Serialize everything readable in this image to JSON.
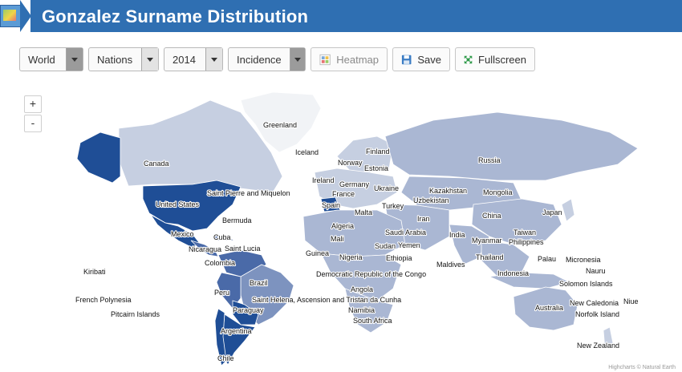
{
  "header": {
    "title": "Gonzalez Surname Distribution",
    "logo_icon": "map-logo-icon"
  },
  "toolbar": {
    "region": "World",
    "level": "Nations",
    "year": "2014",
    "measure": "Incidence",
    "heatmap_label": "Heatmap",
    "save_label": "Save",
    "fullscreen_label": "Fullscreen"
  },
  "zoom": {
    "in_label": "+",
    "out_label": "-"
  },
  "map": {
    "colors": {
      "highest": "#1f4e96",
      "high": "#4a6aa8",
      "medium": "#7d93bf",
      "low": "#aab7d3",
      "lowest": "#c6cfe1",
      "none": "#f1f3f6"
    },
    "labels": {
      "greenland": "Greenland",
      "iceland": "Iceland",
      "finland": "Finland",
      "norway": "Norway",
      "estonia": "Estonia",
      "ireland": "Ireland",
      "germany": "Germany",
      "ukraine": "Ukraine",
      "france": "France",
      "spain": "Spain",
      "malta": "Malta",
      "turkey": "Turkey",
      "russia": "Russia",
      "kazakhstan": "Kazakhstan",
      "uzbekistan": "Uzbekistan",
      "mongolia": "Mongolia",
      "china": "China",
      "japan": "Japan",
      "iran": "Iran",
      "india": "India",
      "saudi_arabia": "Saudi Arabia",
      "yemen": "Yemen",
      "sudan": "Sudan",
      "ethiopia": "Ethiopia",
      "algeria": "Algeria",
      "mali": "Mali",
      "guinea": "Guinea",
      "nigeria": "Nigeria",
      "drc": "Democratic Republic of the Congo",
      "angola": "Angola",
      "namibia": "Namibia",
      "south_africa": "South Africa",
      "maldives": "Maldives",
      "myanmar": "Myanmar",
      "taiwan": "Taiwan",
      "philippines": "Philippines",
      "thailand": "Thailand",
      "palau": "Palau",
      "micronesia": "Micronesia",
      "nauru": "Nauru",
      "indonesia": "Indonesia",
      "solomon_islands": "Solomon Islands",
      "australia": "Australia",
      "new_caledonia": "New Caledonia",
      "niue": "Niue",
      "norfolk_island": "Norfolk Island",
      "new_zealand": "New Zealand",
      "canada": "Canada",
      "united_states": "United States",
      "saint_pierre": "Saint Pierre and Miquelon",
      "bermuda": "Bermuda",
      "mexico": "Mexico",
      "cuba": "Cuba",
      "nicaragua": "Nicaragua",
      "saint_lucia": "Saint Lucia",
      "colombia": "Colombia",
      "peru": "Peru",
      "brazil": "Brazil",
      "paraguay": "Paraguay",
      "saint_helena": "Saint Helena, Ascension and Tristan da Cunha",
      "argentina": "Argentina",
      "chile": "Chile",
      "kiribati": "Kiribati",
      "french_polynesia": "French Polynesia",
      "pitcairn": "Pitcairn Islands"
    },
    "credits": "Highcharts © Natural Earth"
  }
}
